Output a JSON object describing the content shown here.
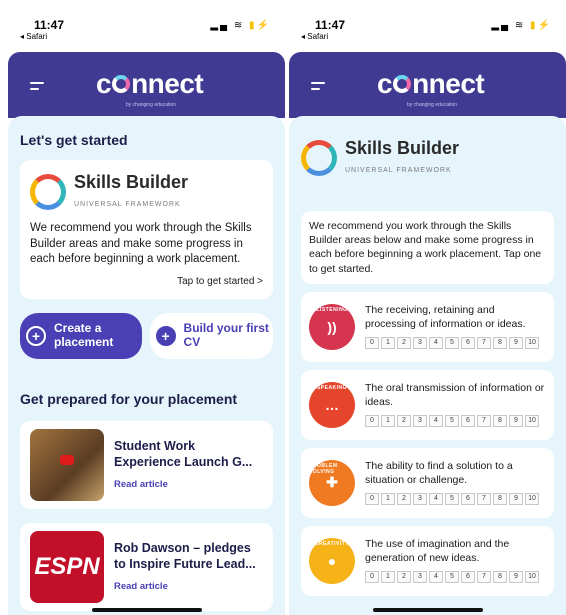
{
  "status": {
    "time": "11:47",
    "back_label": "◂ Safari"
  },
  "app": {
    "logo": "connect",
    "tagline": "by changing education"
  },
  "left": {
    "heading": "Let's get started",
    "skills_builder": {
      "name": "Skills Builder",
      "subtitle": "UNIVERSAL FRAMEWORK"
    },
    "intro": "We recommend you work through the Skills Builder areas and make some progress in each before beginning a work placement.",
    "tap_label": "Tap to get started >",
    "btn_create": "Create a placement",
    "btn_cv": "Build your first CV",
    "section2": "Get prepared for your placement",
    "articles": [
      {
        "title": "Student Work Experience Launch G...",
        "link": "Read article"
      },
      {
        "title": "Rob Dawson – pledges to Inspire Future Lead...",
        "link": "Read article",
        "thumb": "ESPN"
      }
    ]
  },
  "right": {
    "skills_builder": {
      "name": "Skills Builder",
      "subtitle": "UNIVERSAL FRAMEWORK"
    },
    "intro": "We recommend you work through the Skills Builder areas below and make some progress in each before beginning a work placement. Tap one to get started.",
    "scale": [
      "0",
      "1",
      "2",
      "3",
      "4",
      "5",
      "6",
      "7",
      "8",
      "9",
      "10"
    ],
    "skills": [
      {
        "label": "LISTENING",
        "desc": "The receiving, retaining and processing of information or ideas.",
        "color": "#d6354f",
        "icon": "))"
      },
      {
        "label": "SPEAKING",
        "desc": "The oral transmission of information or ideas.",
        "color": "#e5452b",
        "icon": "…"
      },
      {
        "label": "PROBLEM SOLVING",
        "desc": "The ability to find a solution to a situation or challenge.",
        "color": "#f07a22",
        "icon": "✚"
      },
      {
        "label": "CREATIVITY",
        "desc": "The use of imagination and the generation of new ideas.",
        "color": "#f6b318",
        "icon": "●"
      }
    ]
  }
}
